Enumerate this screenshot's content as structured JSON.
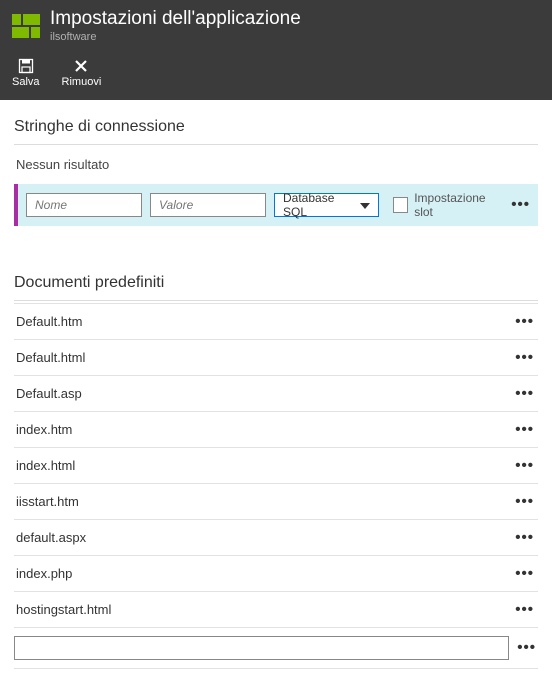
{
  "header": {
    "title": "Impostazioni dell'applicazione",
    "subtitle": "ilsoftware"
  },
  "toolbar": {
    "save_label": "Salva",
    "remove_label": "Rimuovi"
  },
  "conn": {
    "section_title": "Stringhe di connessione",
    "no_result": "Nessun risultato",
    "name_placeholder": "Nome",
    "value_placeholder": "Valore",
    "db_type": "Database SQL",
    "slot_label": "Impostazione slot"
  },
  "docs": {
    "section_title": "Documenti predefiniti",
    "items": [
      "Default.htm",
      "Default.html",
      "Default.asp",
      "index.htm",
      "index.html",
      "iisstart.htm",
      "default.aspx",
      "index.php",
      "hostingstart.html"
    ]
  }
}
